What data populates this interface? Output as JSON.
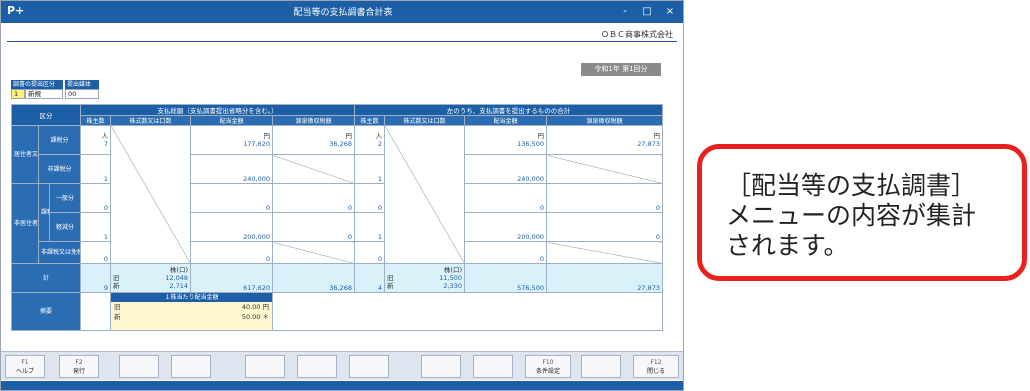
{
  "window": {
    "app_icon": "P+",
    "title": "配当等の支払調書合計表",
    "controls": [
      "-",
      "□",
      "×"
    ],
    "company": "ＯＢＣ商事株式会社",
    "period": "令和1年 第1回分"
  },
  "submit": {
    "category_label": "調書の提出区分",
    "category_code": "1",
    "category_value": "新規",
    "media_label": "提出媒体",
    "media_value": "00"
  },
  "table": {
    "kubun": "区分",
    "group1": "支払総額（支払調書提出省略分を含む。）",
    "group2": "左のうち、支払調書を提出するものの合計",
    "cols": [
      "株主数",
      "株式数又は口数",
      "配当金額",
      "源泉徴収税額",
      "株主数",
      "株式数又は口数",
      "配当金額",
      "源泉徴収税額"
    ],
    "units": {
      "person": "人",
      "yen": "円",
      "shares": "株(口)"
    },
    "resident": "居住者又は内国法人に支払うもの",
    "nonresident": "非居住者又は外国法人に支払うもの",
    "kazei": "課税",
    "rows": [
      {
        "label": "課税分",
        "c1": "7",
        "c3": "177,620",
        "c4": "36,268",
        "c5": "2",
        "c7": "136,500",
        "c8": "27,873"
      },
      {
        "label": "非課税分",
        "c1": "1",
        "c3": "240,000",
        "c4": "",
        "c5": "1",
        "c7": "240,000",
        "c8": ""
      },
      {
        "label": "一般分",
        "c1": "0",
        "c3": "0",
        "c4": "0",
        "c5": "0",
        "c7": "0",
        "c8": "0"
      },
      {
        "label": "軽減分",
        "c1": "1",
        "c3": "200,000",
        "c4": "0",
        "c5": "1",
        "c7": "200,000",
        "c8": "0"
      },
      {
        "label": "非課税又は免税分",
        "c1": "0",
        "c3": "0",
        "c4": "",
        "c5": "0",
        "c7": "0",
        "c8": ""
      }
    ],
    "total": {
      "label": "計",
      "c1": "9",
      "old_label": "旧",
      "new_label": "新",
      "c2_old": "12,048",
      "c2_new": "2,714",
      "c3": "617,620",
      "c4": "36,268",
      "c5": "4",
      "c6_old": "11,500",
      "c6_new": "2,330",
      "c7": "576,500",
      "c8": "27,873"
    },
    "memo": {
      "label": "摘要",
      "header": "１株当たり配当金額",
      "old_label": "旧",
      "old_value": "40.00 円",
      "new_label": "新",
      "new_value": "50.00 ＊"
    }
  },
  "fkeys": [
    {
      "fn": "F1",
      "label": "ヘルプ"
    },
    {
      "fn": "F2",
      "label": "発行"
    },
    {
      "fn": "",
      "label": ""
    },
    {
      "fn": "",
      "label": ""
    },
    {
      "fn": "",
      "label": ""
    },
    {
      "fn": "",
      "label": ""
    },
    {
      "fn": "",
      "label": ""
    },
    {
      "fn": "",
      "label": ""
    },
    {
      "fn": "",
      "label": ""
    },
    {
      "fn": "",
      "label": ""
    },
    {
      "fn": "F10",
      "label": "条件設定"
    },
    {
      "fn": "",
      "label": ""
    },
    {
      "fn": "F12",
      "label": "閉じる"
    }
  ],
  "callout": "［配当等の支払調書］\nメニューの内容が集計\nされます。",
  "colors": {
    "titlebar": "#1d5fa6",
    "callout_border": "#e8201f",
    "total_bg": "#d9f2fa"
  }
}
